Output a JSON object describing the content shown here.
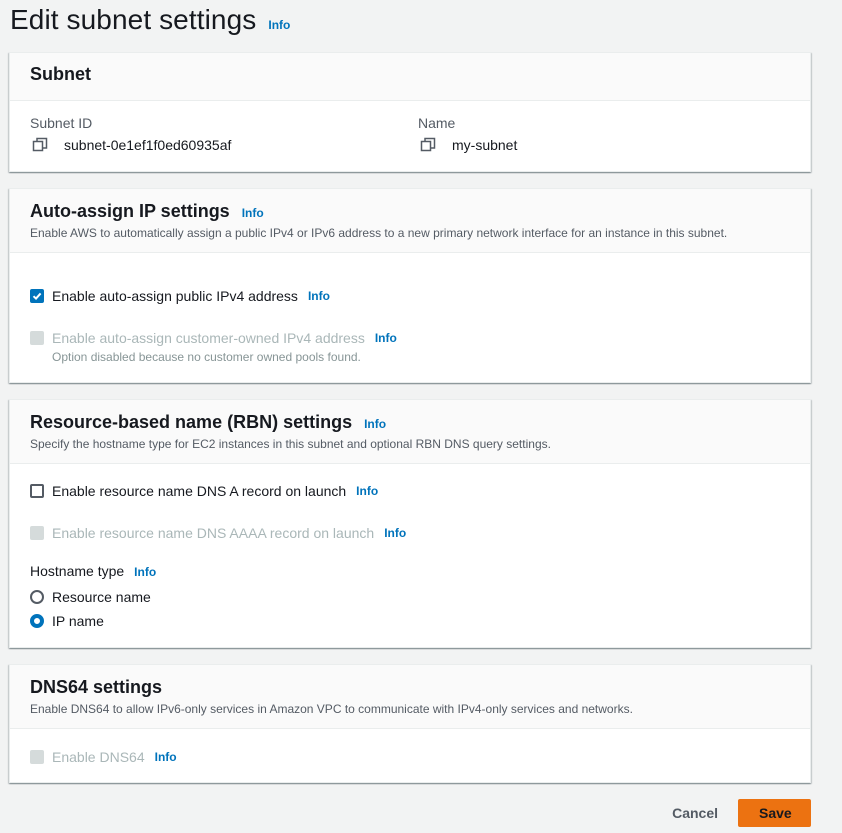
{
  "page": {
    "title": "Edit subnet settings",
    "info": "Info"
  },
  "subnet": {
    "heading": "Subnet",
    "id_label": "Subnet ID",
    "id_value": "subnet-0e1ef1f0ed60935af",
    "name_label": "Name",
    "name_value": "my-subnet"
  },
  "auto_assign": {
    "heading": "Auto-assign IP settings",
    "info": "Info",
    "description": "Enable AWS to automatically assign a public IPv4 or IPv6 address to a new primary network interface for an instance in this subnet.",
    "ipv4_label": "Enable auto-assign public IPv4 address",
    "ipv4_checked": true,
    "ipv4_info": "Info",
    "customer_label": "Enable auto-assign customer-owned IPv4 address",
    "customer_info": "Info",
    "customer_note": "Option disabled because no customer owned pools found."
  },
  "rbn": {
    "heading": "Resource-based name (RBN) settings",
    "info": "Info",
    "description": "Specify the hostname type for EC2 instances in this subnet and optional RBN DNS query settings.",
    "dns_a_label": "Enable resource name DNS A record on launch",
    "dns_a_info": "Info",
    "dns_aaaa_label": "Enable resource name DNS AAAA record on launch",
    "dns_aaaa_info": "Info",
    "hostname_label": "Hostname type",
    "hostname_info": "Info",
    "options": [
      "Resource name",
      "IP name"
    ],
    "selected": "IP name"
  },
  "dns64": {
    "heading": "DNS64 settings",
    "description": "Enable DNS64 to allow IPv6-only services in Amazon VPC to communicate with IPv4-only services and networks.",
    "enable_label": "Enable DNS64",
    "enable_info": "Info"
  },
  "actions": {
    "cancel": "Cancel",
    "save": "Save"
  },
  "colors": {
    "accent": "#0073bb",
    "primary_button": "#ec7211",
    "disabled": "#aab7b8"
  }
}
